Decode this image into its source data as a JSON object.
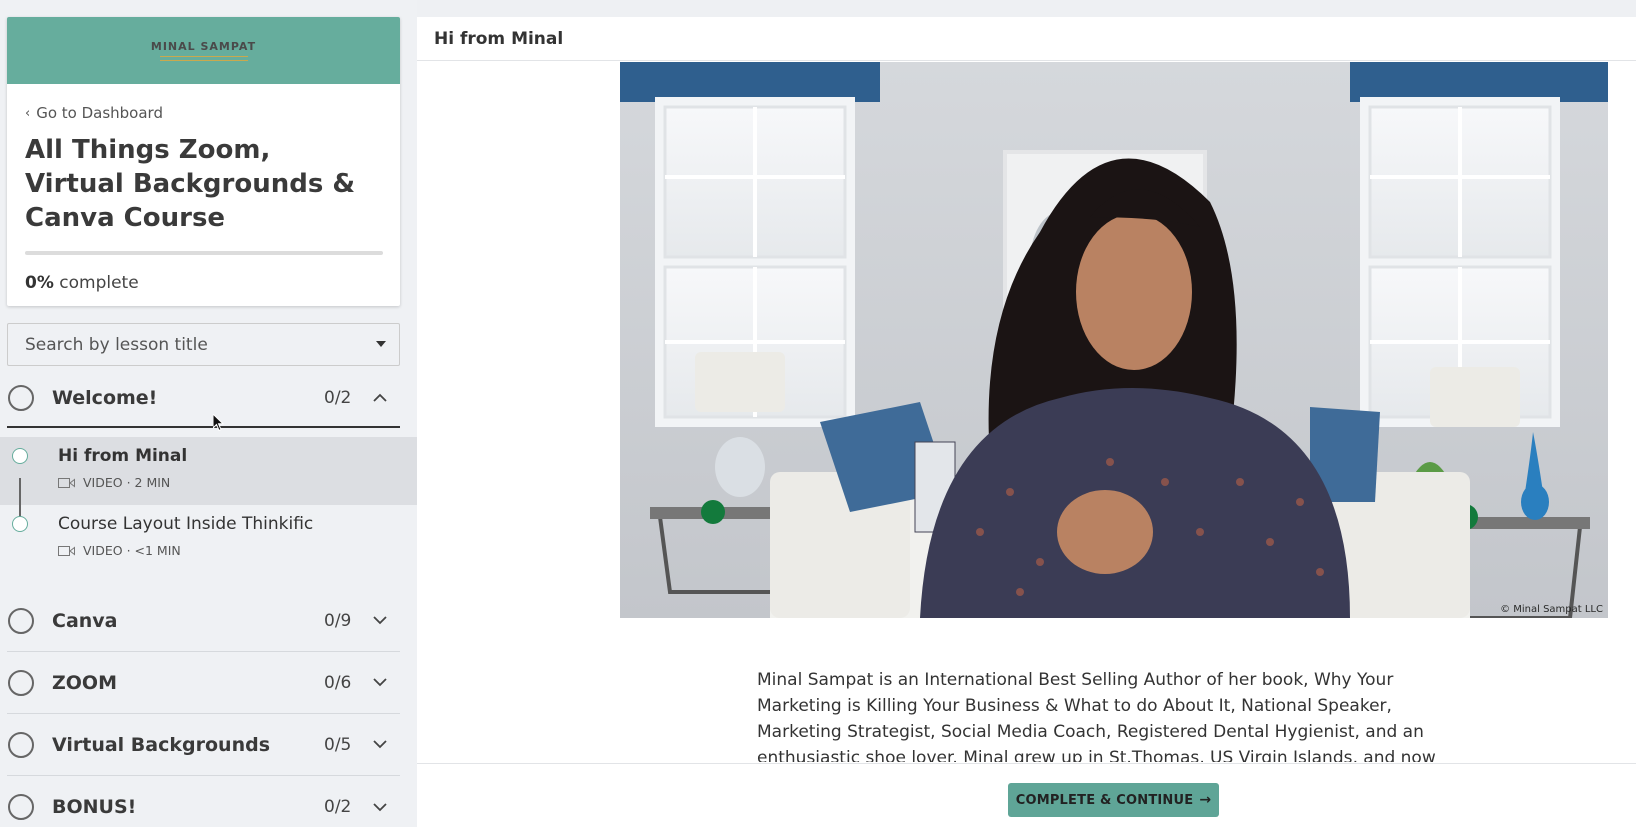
{
  "sidebar": {
    "brand": "MINAL SAMPAT",
    "back_link": "Go to Dashboard",
    "course_title": "All Things Zoom, Virtual Backgrounds & Canva Course",
    "progress_value": 0,
    "progress_percent": "0%",
    "progress_suffix": "complete",
    "search_placeholder": "Search by lesson title",
    "chapters": [
      {
        "title": "Welcome!",
        "count": "0/2",
        "expanded": true
      },
      {
        "title": "Canva",
        "count": "0/9",
        "expanded": false
      },
      {
        "title": "ZOOM",
        "count": "0/6",
        "expanded": false
      },
      {
        "title": "Virtual Backgrounds",
        "count": "0/5",
        "expanded": false
      },
      {
        "title": "BONUS!",
        "count": "0/2",
        "expanded": false
      }
    ],
    "lessons": [
      {
        "title": "Hi from Minal",
        "meta": "VIDEO · 2 MIN",
        "active": true
      },
      {
        "title": "Course Layout Inside Thinkific",
        "meta": "VIDEO · <1 MIN",
        "active": false
      }
    ]
  },
  "main": {
    "header_title": "Hi from Minal",
    "video_watermark": "© Minal Sampat LLC",
    "description": "Minal Sampat is an International Best Selling Author of her book, Why Your Marketing is Killing Your Business & What to do About It, National Speaker, Marketing Strategist, Social Media Coach, Registered Dental Hygienist, and an enthusiastic shoe lover. Minal grew up in St.Thomas, US Virgin Islands, and now",
    "cta_label": "COMPLETE & CONTINUE",
    "cta_icon": "arrow-right-icon"
  },
  "colors": {
    "brand_teal": "#66ad9d",
    "cta_teal": "#5fa597",
    "sidebar_bg": "#eff1f4"
  }
}
